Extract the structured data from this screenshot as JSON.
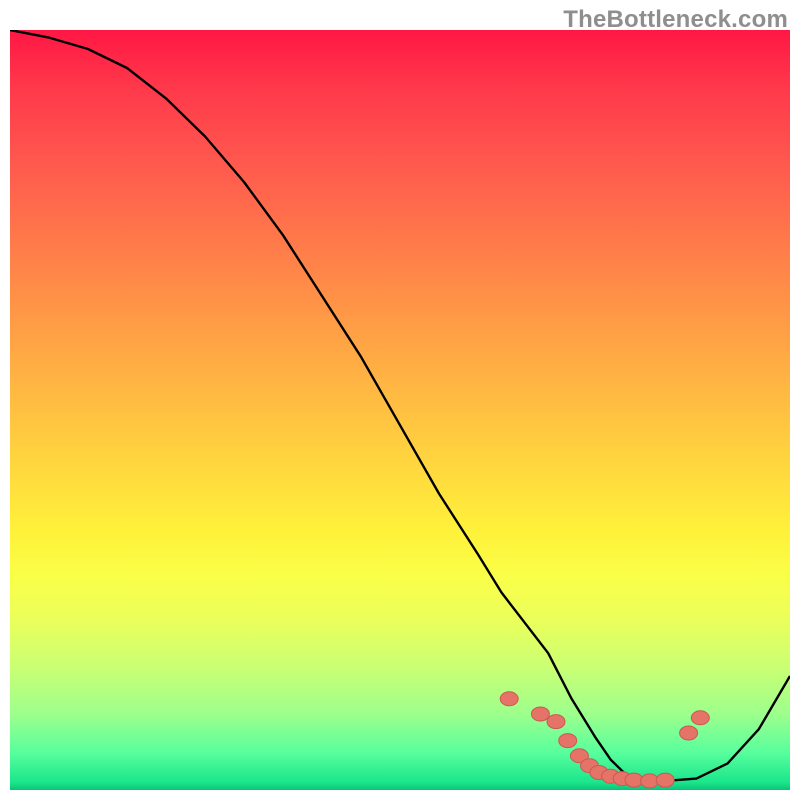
{
  "watermark": "TheBottleneck.com",
  "colors": {
    "curve": "#000000",
    "dot_fill": "#e57368",
    "dot_stroke": "#c85a52"
  },
  "chart_data": {
    "type": "line",
    "title": "",
    "xlabel": "",
    "ylabel": "",
    "xlim": [
      0,
      100
    ],
    "ylim": [
      0,
      100
    ],
    "series": [
      {
        "name": "curve",
        "x": [
          0,
          5,
          10,
          15,
          20,
          25,
          30,
          35,
          40,
          45,
          50,
          55,
          60,
          63,
          66,
          69,
          72,
          75,
          77,
          79,
          81,
          84,
          88,
          92,
          96,
          100
        ],
        "y": [
          100,
          99,
          97.5,
          95,
          91,
          86,
          80,
          73,
          65,
          57,
          48,
          39,
          31,
          26,
          22,
          18,
          12,
          7,
          4,
          2,
          1.5,
          1.2,
          1.5,
          3.5,
          8,
          15
        ]
      }
    ],
    "dots": {
      "name": "highlight-points",
      "x": [
        64,
        68,
        70,
        71.5,
        73,
        74.3,
        75.5,
        77,
        78.5,
        80,
        82,
        84,
        87,
        88.5
      ],
      "y": [
        12,
        10,
        9,
        6.5,
        4.5,
        3.2,
        2.3,
        1.8,
        1.5,
        1.3,
        1.2,
        1.3,
        7.5,
        9.5
      ]
    }
  }
}
